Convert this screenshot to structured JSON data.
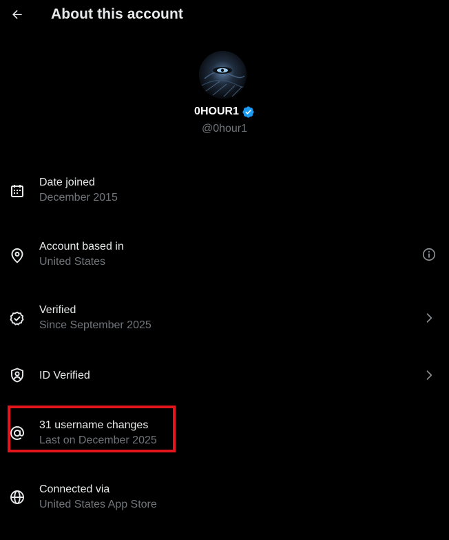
{
  "header": {
    "title": "About this account"
  },
  "profile": {
    "name": "0HOUR1",
    "handle": "@0hour1",
    "verified_color": "#1d9bf0"
  },
  "rows": [
    {
      "icon": "calendar-icon",
      "title": "Date joined",
      "subtitle": "December 2015",
      "trailing": ""
    },
    {
      "icon": "location-pin-icon",
      "title": "Account based in",
      "subtitle": "United States",
      "trailing": "info-icon"
    },
    {
      "icon": "verified-badge-icon",
      "title": "Verified",
      "subtitle": "Since September 2025",
      "trailing": "chevron-right-icon"
    },
    {
      "icon": "shield-user-icon",
      "title": "ID Verified",
      "subtitle": "",
      "trailing": "chevron-right-icon"
    },
    {
      "icon": "at-sign-icon",
      "title": "31 username changes",
      "subtitle": "Last on December 2025",
      "trailing": ""
    },
    {
      "icon": "globe-icon",
      "title": "Connected via",
      "subtitle": "United States App Store",
      "trailing": ""
    }
  ],
  "annotation": {
    "highlight_color": "#e1151b"
  }
}
